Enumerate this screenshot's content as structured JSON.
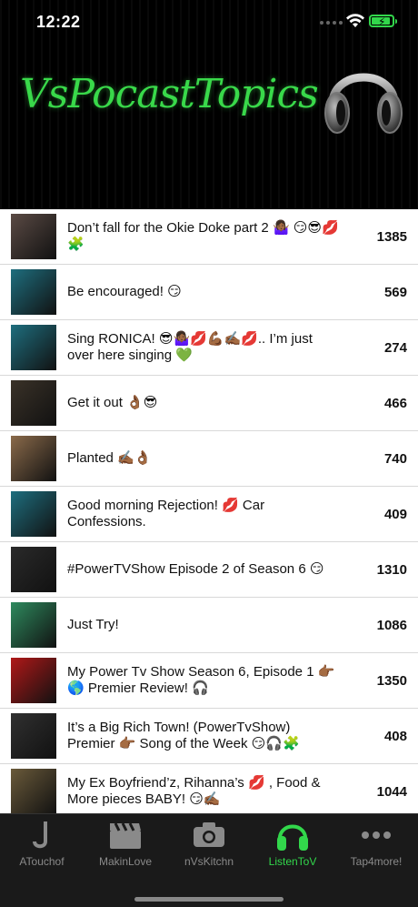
{
  "status": {
    "time": "12:22"
  },
  "header": {
    "logo_text": "VsPocastTopics",
    "icon": "headphones-icon"
  },
  "episodes": [
    {
      "title": "Don’t fall for the Okie Doke part 2 🤷🏾‍♀️ 😏😎💋 🧩",
      "count": "1385",
      "thumb_color": "#5a4a44"
    },
    {
      "title": "Be encouraged! 😏",
      "count": "569",
      "thumb_color": "#1e6e7e"
    },
    {
      "title": "Sing RONICA! 😎🤷🏾‍♀️💋💪🏾✍🏾💋.. I’m just over here singing 💚",
      "count": "274",
      "thumb_color": "#1e6e7e"
    },
    {
      "title": "Get it out 👌🏾😎",
      "count": "466",
      "thumb_color": "#3a3228"
    },
    {
      "title": "Planted ✍🏾👌🏾",
      "count": "740",
      "thumb_color": "#8a6a4a"
    },
    {
      "title": "Good morning Rejection! 💋 Car Confessions.",
      "count": "409",
      "thumb_color": "#1e6e7e"
    },
    {
      "title": "#PowerTVShow Episode 2 of Season 6 😏",
      "count": "1310",
      "thumb_color": "#2a2a2a"
    },
    {
      "title": "Just Try!",
      "count": "1086",
      "thumb_color": "#2e8a5e"
    },
    {
      "title": "My Power Tv Show Season 6, Episode 1 👉🏾🌎 Premier Review! 🎧",
      "count": "1350",
      "thumb_color": "#b01818"
    },
    {
      "title": "It’s a Big Rich Town! (PowerTvShow) Premier 👉🏾 Song of the Week 😏🎧🧩",
      "count": "408",
      "thumb_color": "#303030"
    },
    {
      "title": "My Ex Boyfriend’z, Rihanna’s 💋 , Food & More pieces BABY! 😏✍🏾",
      "count": "1044",
      "thumb_color": "#6a5a3a"
    }
  ],
  "tabs": [
    {
      "label": "ATouchof",
      "icon": "letter-j-icon"
    },
    {
      "label": "MakinLove",
      "icon": "clapperboard-icon"
    },
    {
      "label": "nVsKitchn",
      "icon": "camera-icon"
    },
    {
      "label": "ListenToV",
      "icon": "headphones-icon"
    },
    {
      "label": "Tap4more!",
      "icon": "more-dots-icon"
    }
  ],
  "colors": {
    "accent": "#32d74b",
    "header_bg": "#000000",
    "tabbar_bg": "#1a1a1a"
  }
}
